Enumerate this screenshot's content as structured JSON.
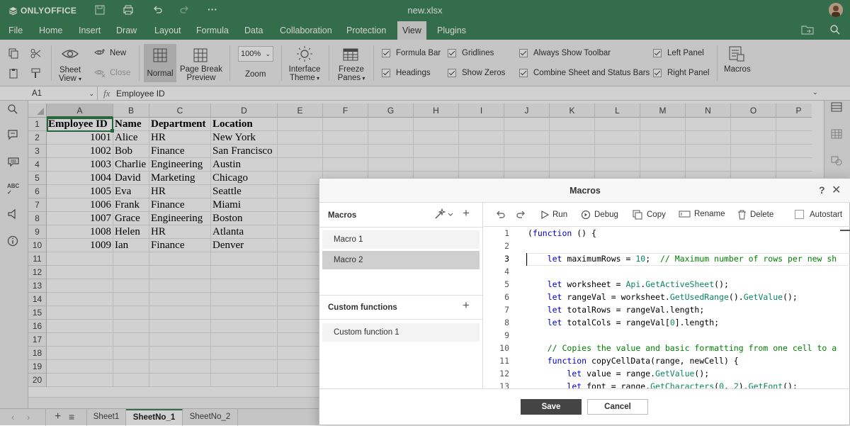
{
  "titlebar": {
    "brand": "ONLYOFFICE",
    "filename": "new.xlsx"
  },
  "menu": {
    "items": [
      "File",
      "Home",
      "Insert",
      "Draw",
      "Layout",
      "Formula",
      "Data",
      "Collaboration",
      "Protection",
      "View",
      "Plugins"
    ],
    "active": "View"
  },
  "ribbon": {
    "sheet_view": "Sheet View",
    "new": "New",
    "close": "Close",
    "normal": "Normal",
    "page_break_preview": "Page Break Preview",
    "zoom_value": "100%",
    "zoom": "Zoom",
    "interface_theme": "Interface Theme",
    "freeze_panes": "Freeze Panes",
    "checkboxes": [
      {
        "label": "Formula Bar",
        "checked": true
      },
      {
        "label": "Headings",
        "checked": true
      },
      {
        "label": "Gridlines",
        "checked": true
      },
      {
        "label": "Show Zeros",
        "checked": true
      },
      {
        "label": "Always Show Toolbar",
        "checked": true
      },
      {
        "label": "Combine Sheet and Status Bars",
        "checked": true
      },
      {
        "label": "Left Panel",
        "checked": true
      },
      {
        "label": "Right Panel",
        "checked": true
      }
    ],
    "macros": "Macros"
  },
  "formula_bar": {
    "cell_ref": "A1",
    "fx": "fx",
    "value": "Employee ID"
  },
  "grid": {
    "columns": [
      "A",
      "B",
      "C",
      "D",
      "E",
      "F",
      "G",
      "H",
      "I",
      "J",
      "K",
      "L",
      "M",
      "N",
      "O",
      "P"
    ],
    "row_numbers": [
      "1",
      "2",
      "3",
      "4",
      "5",
      "6",
      "7",
      "8",
      "9",
      "10",
      "11",
      "12",
      "13",
      "14",
      "15",
      "16",
      "17",
      "18",
      "19",
      "20"
    ],
    "headers": [
      "Employee ID",
      "Name",
      "Department",
      "Location"
    ],
    "rows": [
      [
        "1001",
        "Alice",
        "HR",
        "New York"
      ],
      [
        "1002",
        "Bob",
        "Finance",
        "San Francisco"
      ],
      [
        "1003",
        "Charlie",
        "Engineering",
        "Austin"
      ],
      [
        "1004",
        "David",
        "Marketing",
        "Chicago"
      ],
      [
        "1005",
        "Eva",
        "HR",
        "Seattle"
      ],
      [
        "1006",
        "Frank",
        "Finance",
        "Miami"
      ],
      [
        "1007",
        "Grace",
        "Engineering",
        "Boston"
      ],
      [
        "1008",
        "Helen",
        "HR",
        "Atlanta"
      ],
      [
        "1009",
        "Ian",
        "Finance",
        "Denver"
      ]
    ]
  },
  "sheets": {
    "tabs": [
      "Sheet1",
      "SheetNo_1",
      "SheetNo_2"
    ],
    "active": "SheetNo_1"
  },
  "dialog": {
    "title": "Macros",
    "help": "?",
    "macros_heading": "Macros",
    "macros": [
      "Macro 1",
      "Macro 2"
    ],
    "selected_macro": "Macro 2",
    "custom_functions_heading": "Custom functions",
    "custom_functions": [
      "Custom function 1"
    ],
    "toolbar": {
      "run": "Run",
      "debug": "Debug",
      "copy": "Copy",
      "rename": "Rename",
      "delete": "Delete",
      "autostart": "Autostart"
    },
    "code_lines": [
      "(function () {",
      "",
      "    let maximumRows = 10;  // Maximum number of rows per new sh",
      "",
      "    let worksheet = Api.GetActiveSheet();",
      "    let rangeVal = worksheet.GetUsedRange().GetValue();",
      "    let totalRows = rangeVal.length;",
      "    let totalCols = rangeVal[0].length;",
      "",
      "    // Copies the value and basic formatting from one cell to a",
      "    function copyCellData(range, newCell) {",
      "        let value = range.GetValue();",
      "        let font = range.GetCharacters(0, 2).GetFont();"
    ],
    "line_numbers": [
      "1",
      "2",
      "3",
      "4",
      "5",
      "6",
      "7",
      "8",
      "9",
      "10",
      "11",
      "12",
      "13"
    ],
    "save": "Save",
    "cancel": "Cancel"
  }
}
